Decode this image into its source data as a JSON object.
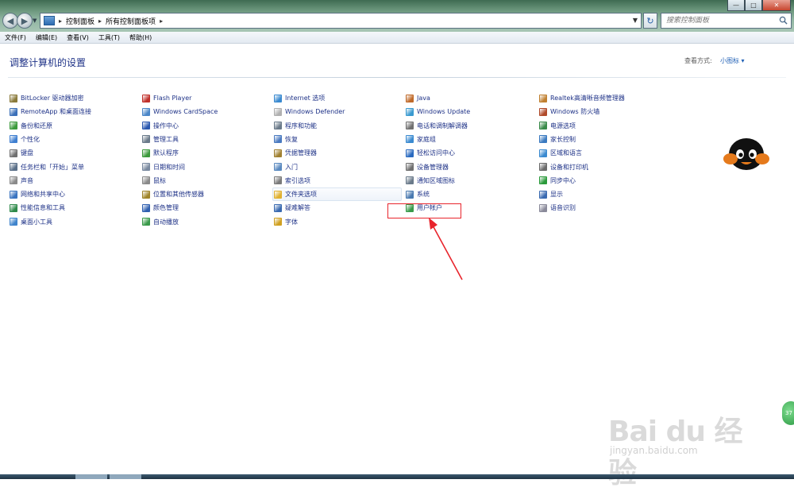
{
  "address": {
    "crumbs": [
      "控制面板",
      "所有控制面板项"
    ],
    "search_placeholder": "搜索控制面板"
  },
  "menu": [
    "文件(F)",
    "编辑(E)",
    "查看(V)",
    "工具(T)",
    "帮助(H)"
  ],
  "header": {
    "title": "调整计算机的设置",
    "view_by_label": "查看方式:",
    "view_by_value": "小图标"
  },
  "columns": [
    [
      {
        "label": "BitLocker 驱动器加密",
        "icon": "bitlocker-icon",
        "color": "#8a7a3a"
      },
      {
        "label": "RemoteApp 和桌面连接",
        "icon": "remoteapp-icon",
        "color": "#3a6fb8"
      },
      {
        "label": "备份和还原",
        "icon": "backup-icon",
        "color": "#3c9a3c"
      },
      {
        "label": "个性化",
        "icon": "personalize-icon",
        "color": "#3f7fd0"
      },
      {
        "label": "键盘",
        "icon": "keyboard-icon",
        "color": "#707070"
      },
      {
        "label": "任务栏和「开始」菜单",
        "icon": "taskbar-icon",
        "color": "#5a6f88"
      },
      {
        "label": "声音",
        "icon": "sound-icon",
        "color": "#8a8a8a"
      },
      {
        "label": "网络和共享中心",
        "icon": "network-icon",
        "color": "#3a74c0"
      },
      {
        "label": "性能信息和工具",
        "icon": "performance-icon",
        "color": "#2f8a4a"
      },
      {
        "label": "桌面小工具",
        "icon": "gadgets-icon",
        "color": "#3f84cc"
      }
    ],
    [
      {
        "label": "Flash Player",
        "icon": "flash-icon",
        "color": "#c0302a"
      },
      {
        "label": "Windows CardSpace",
        "icon": "cardspace-icon",
        "color": "#4a86c8"
      },
      {
        "label": "操作中心",
        "icon": "flag-icon",
        "color": "#2a58b0"
      },
      {
        "label": "管理工具",
        "icon": "admin-tools-icon",
        "color": "#6a7a8a"
      },
      {
        "label": "默认程序",
        "icon": "default-programs-icon",
        "color": "#3c9a3c"
      },
      {
        "label": "日期和时间",
        "icon": "clock-icon",
        "color": "#7a8aa0"
      },
      {
        "label": "鼠标",
        "icon": "mouse-icon",
        "color": "#8a8a8a"
      },
      {
        "label": "位置和其他传感器",
        "icon": "sensor-icon",
        "color": "#a0852a"
      },
      {
        "label": "颜色管理",
        "icon": "color-icon",
        "color": "#3060b0"
      },
      {
        "label": "自动播放",
        "icon": "autoplay-icon",
        "color": "#3a9a4a"
      }
    ],
    [
      {
        "label": "Internet 选项",
        "icon": "internet-icon",
        "color": "#3a8ad0"
      },
      {
        "label": "Windows Defender",
        "icon": "defender-icon",
        "color": "#b0b0b0"
      },
      {
        "label": "程序和功能",
        "icon": "programs-icon",
        "color": "#6a7a8a"
      },
      {
        "label": "恢复",
        "icon": "recovery-icon",
        "color": "#4a7ac0"
      },
      {
        "label": "凭据管理器",
        "icon": "credential-icon",
        "color": "#a08030"
      },
      {
        "label": "入门",
        "icon": "getting-started-icon",
        "color": "#5a8ac0"
      },
      {
        "label": "索引选项",
        "icon": "index-icon",
        "color": "#7a7a7a"
      },
      {
        "label": "文件夹选项",
        "icon": "folder-icon",
        "color": "#e0b030"
      },
      {
        "label": "疑难解答",
        "icon": "troubleshoot-icon",
        "color": "#3a6ab0"
      },
      {
        "label": "字体",
        "icon": "font-icon",
        "color": "#d0a020"
      }
    ],
    [
      {
        "label": "Java",
        "icon": "java-icon",
        "color": "#c06a2a"
      },
      {
        "label": "Windows Update",
        "icon": "update-icon",
        "color": "#3a9ad0"
      },
      {
        "label": "电话和调制解调器",
        "icon": "phone-icon",
        "color": "#707070"
      },
      {
        "label": "家庭组",
        "icon": "homegroup-icon",
        "color": "#3a8ad0"
      },
      {
        "label": "轻松访问中心",
        "icon": "ease-access-icon",
        "color": "#2a6ac0"
      },
      {
        "label": "设备管理器",
        "icon": "device-manager-icon",
        "color": "#707070"
      },
      {
        "label": "通知区域图标",
        "icon": "notification-icon",
        "color": "#6a7a8a"
      },
      {
        "label": "系统",
        "icon": "system-icon",
        "color": "#4a7ab0"
      },
      {
        "label": "用户帐户",
        "icon": "user-accounts-icon",
        "color": "#3a9a4a"
      }
    ],
    [
      {
        "label": "Realtek高清晰音频管理器",
        "icon": "realtek-icon",
        "color": "#c08030"
      },
      {
        "label": "Windows 防火墙",
        "icon": "firewall-icon",
        "color": "#b04a2a"
      },
      {
        "label": "电源选项",
        "icon": "power-icon",
        "color": "#3a8a4a"
      },
      {
        "label": "家长控制",
        "icon": "parental-icon",
        "color": "#3a7ac0"
      },
      {
        "label": "区域和语言",
        "icon": "region-icon",
        "color": "#3a8ad0"
      },
      {
        "label": "设备和打印机",
        "icon": "printer-icon",
        "color": "#6a6a6a"
      },
      {
        "label": "同步中心",
        "icon": "sync-icon",
        "color": "#2a9a3a"
      },
      {
        "label": "显示",
        "icon": "display-icon",
        "color": "#3a6ab0"
      },
      {
        "label": "语音识别",
        "icon": "microphone-icon",
        "color": "#8a8a9a"
      }
    ]
  ],
  "watermark": {
    "brand": "Bai du 经验",
    "url": "jingyan.baidu.com"
  },
  "badge": "37"
}
